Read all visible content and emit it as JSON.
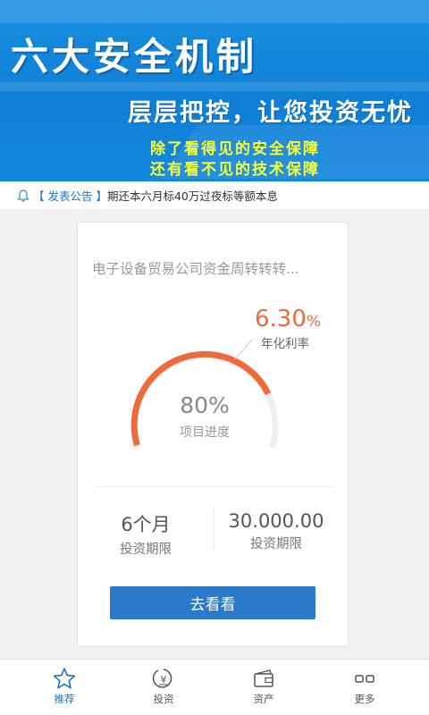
{
  "banner": {
    "headline": "六大安全机制",
    "subheadline": "层层把控，让您投资无忧",
    "line1": "除了看得见的安全保障",
    "line2": "还有看不见的技术保障"
  },
  "notice": {
    "tag": "【 发表公告 】",
    "text": "期还本六月标40万过夜标等额本息"
  },
  "product": {
    "title": "电子设备贸易公司资金周转转转...",
    "rate_value": "6.30",
    "rate_unit": "%",
    "rate_label": "年化利率",
    "progress_value": "80%",
    "progress_fraction": 0.8,
    "progress_label": "项目进度",
    "term_value": "6个月",
    "term_label": "投资期限",
    "amount_value": "30.000.00",
    "amount_label": "投资期限",
    "button_label": "去看看"
  },
  "nav": {
    "items": [
      {
        "label": "推荐",
        "icon": "star-icon",
        "active": true
      },
      {
        "label": "投资",
        "icon": "yen-coin-icon",
        "active": false
      },
      {
        "label": "资产",
        "icon": "wallet-icon",
        "active": false
      },
      {
        "label": "更多",
        "icon": "more-icon",
        "active": false
      }
    ]
  },
  "colors": {
    "banner_blue": "#1487dc",
    "accent_orange": "#ee6a3c",
    "button_blue": "#2b7ac9",
    "nav_active": "#1e73c6",
    "slogan_yellow": "#f4ff3a"
  }
}
